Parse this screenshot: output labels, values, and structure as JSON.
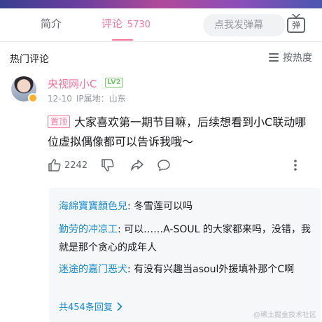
{
  "tabs": {
    "intro": "简介",
    "comments": "评论",
    "comments_count": "5730"
  },
  "danmaku": {
    "placeholder": "点我发弹幕",
    "button_label": "弹"
  },
  "section": {
    "title": "热门评论",
    "sort_label": "按热度"
  },
  "comment": {
    "username": "央视网小C",
    "level": "LV2",
    "date": "12-10",
    "ip_location": "IP属地：山东",
    "pin_label": "置顶",
    "text": "大家喜欢第一期节目嘛，后续想看到小C联动哪位虚拟偶像都可以告诉我哦～",
    "likes": "2242"
  },
  "replies": [
    {
      "name": "海綿寶寶顏色兒",
      "text": ": 冬雪莲可以吗"
    },
    {
      "name": "勤劳的冲凉工",
      "text": ": 可以……A-SOUL 的大家都来吗，没错，我就是那个贪心的成年人"
    },
    {
      "name": "迷途的嘉门恶犬",
      "text": ": 有没有兴趣当asoul外援填补那个C啊"
    }
  ],
  "more_replies": "共454条回复",
  "watermark": "@稀土掘金技术社区",
  "colors": {
    "accent_pink": "#fb7299",
    "link_blue": "#178bcf",
    "level_green": "#7bc96f"
  },
  "icons": {
    "like": "thumbs-up-icon",
    "dislike": "thumbs-down-icon",
    "share": "share-arrow-icon",
    "reply": "chat-bubble-icon",
    "more": "vertical-dots-icon",
    "sort": "sort-lines-icon",
    "danmaku": "tv-icon",
    "more_replies": "chevron-right-icon"
  }
}
